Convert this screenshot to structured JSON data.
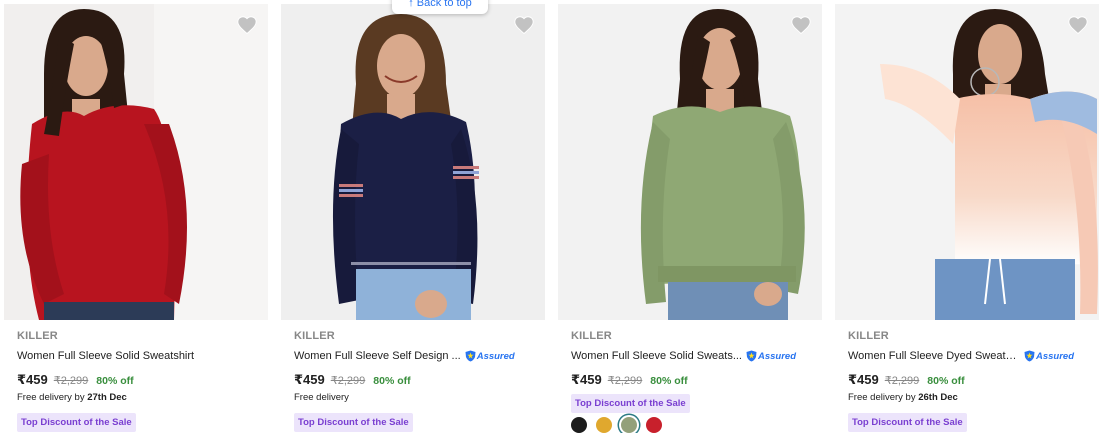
{
  "back_to_top": {
    "icon": "arrow-up-icon",
    "label": "↑ Back to top"
  },
  "products": [
    {
      "brand": "KILLER",
      "title": "Women Full Sleeve Solid Sweatshirt",
      "assured": false,
      "price": "₹459",
      "mrp": "₹2,299",
      "discount": "80% off",
      "delivery_prefix": "Free delivery by ",
      "delivery_date": "27th Dec",
      "badge": "Top Discount of the Sale",
      "image_colors": {
        "bg": "#f1efee",
        "garment": "#b8141f",
        "hair": "#2b1a12",
        "skin": "#d9a98c",
        "jeans": "#2c3b57"
      }
    },
    {
      "brand": "KILLER",
      "title": "Women Full Sleeve Self Design ...",
      "assured": true,
      "assured_label": "Assured",
      "price": "₹459",
      "mrp": "₹2,299",
      "discount": "80% off",
      "delivery_prefix": "Free delivery",
      "delivery_date": "",
      "badge": "Top Discount of the Sale",
      "image_colors": {
        "bg": "#efefef",
        "garment": "#1b1f45",
        "hair": "#5a3a22",
        "skin": "#d9a98c",
        "jeans": "#8fb2d9"
      }
    },
    {
      "brand": "KILLER",
      "title": "Women Full Sleeve Solid Sweats...",
      "assured": true,
      "assured_label": "Assured",
      "price": "₹459",
      "mrp": "₹2,299",
      "discount": "80% off",
      "delivery_prefix": "",
      "delivery_date": "",
      "badge": "Top Discount of the Sale",
      "swatches": [
        "#1c1c1c",
        "#e0a82e",
        "#93a07a",
        "#c8202c"
      ],
      "selected_swatch": 2,
      "image_colors": {
        "bg": "#f2f2f2",
        "garment": "#8fa874",
        "hair": "#2b1a12",
        "skin": "#d9a98c",
        "jeans": "#6f8fb6"
      }
    },
    {
      "brand": "KILLER",
      "title": "Women Full Sleeve Dyed Sweats...",
      "assured": true,
      "assured_label": "Assured",
      "price": "₹459",
      "mrp": "₹2,299",
      "discount": "80% off",
      "delivery_prefix": "Free delivery by ",
      "delivery_date": "26th Dec",
      "badge": "Top Discount of the Sale",
      "image_colors": {
        "bg": "#f3f3f3",
        "garment": "#f7c9b4",
        "hair": "#2b1a12",
        "skin": "#d9a98c",
        "jeans": "#6e94c4"
      }
    }
  ]
}
